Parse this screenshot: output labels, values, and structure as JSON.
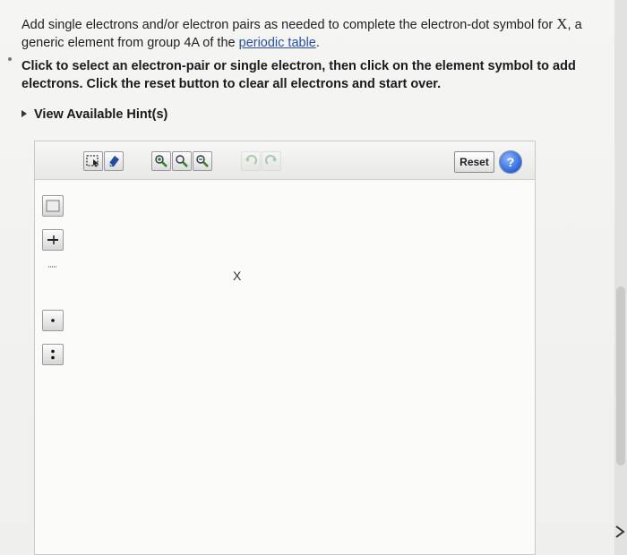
{
  "question": {
    "text_before": "Add single electrons and/or electron pairs as needed to complete the electron-dot symbol for ",
    "symbol": "X",
    "text_after": ", a generic element from group 4A of the ",
    "link_text": "periodic table",
    "text_end": "."
  },
  "instructions": "Click to select an electron-pair or single electron, then click on the element symbol to add electrons. Click the reset button to clear all electrons and start over.",
  "hint_label": "View Available Hint(s)",
  "toolbar": {
    "reset_label": "Reset",
    "help_label": "?"
  },
  "canvas": {
    "element_symbol": "X"
  },
  "icons": {
    "select": "select-arrow-icon",
    "eraser": "eraser-icon",
    "zoom_in": "zoom-in-icon",
    "zoom_fit": "zoom-fit-icon",
    "zoom_out": "zoom-out-icon",
    "undo": "undo-icon",
    "redo": "redo-icon",
    "help": "help-icon"
  },
  "colors": {
    "link": "#2a4f9e",
    "help_button": "#2d64d8"
  }
}
